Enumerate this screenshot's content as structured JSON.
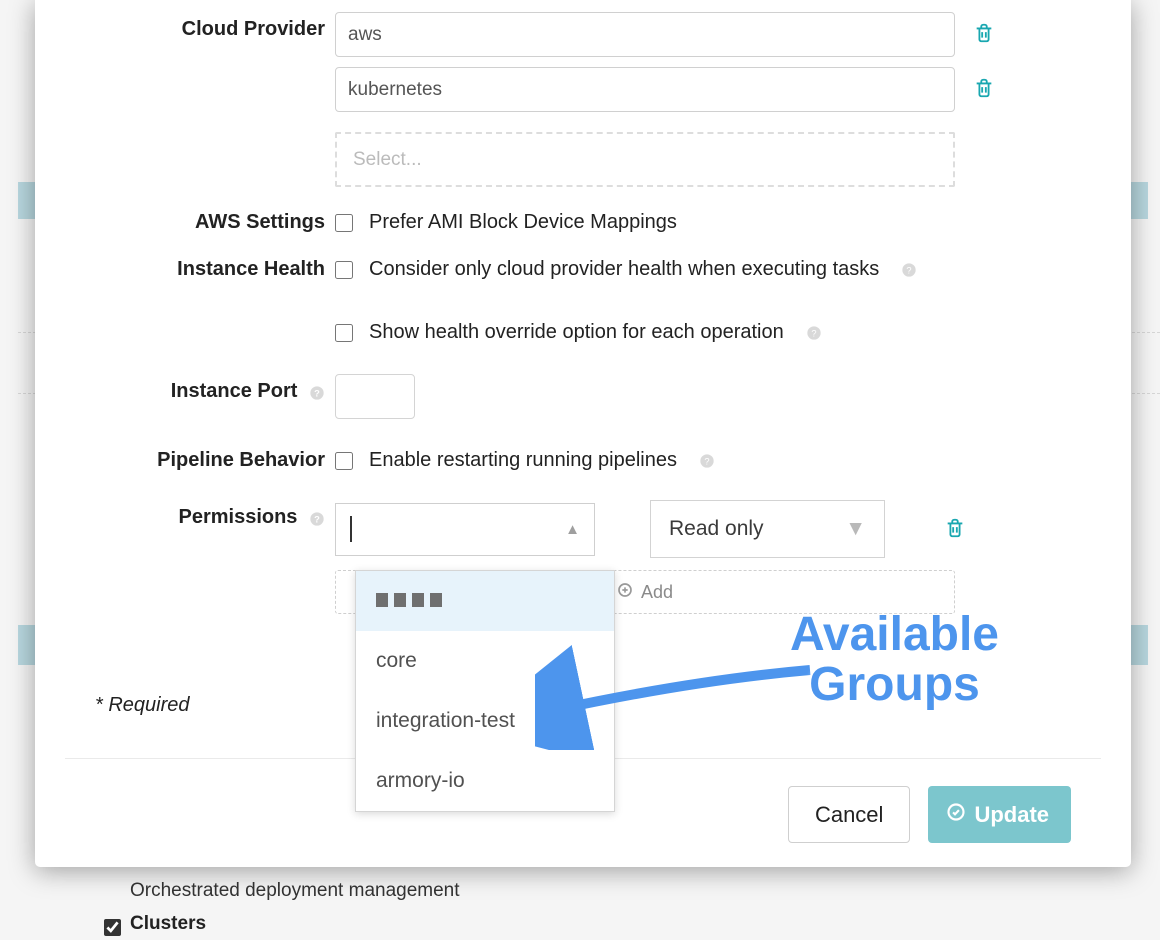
{
  "backdrop": {
    "orchestrated_label": "Orchestrated deployment management",
    "clusters_label": "Clusters"
  },
  "form": {
    "cloud_provider": {
      "label": "Cloud Provider",
      "values": [
        "aws",
        "kubernetes"
      ],
      "select_placeholder": "Select..."
    },
    "aws_settings": {
      "label": "AWS Settings",
      "option": "Prefer AMI Block Device Mappings"
    },
    "instance_health": {
      "label": "Instance Health",
      "option1": "Consider only cloud provider health when executing tasks",
      "option2": "Show health override option for each operation"
    },
    "instance_port": {
      "label": "Instance Port",
      "value": ""
    },
    "pipeline_behavior": {
      "label": "Pipeline Behavior",
      "option": "Enable restarting running pipelines"
    },
    "permissions": {
      "label": "Permissions",
      "level_selected": "Read only",
      "add_label": "Add",
      "dropdown_options": [
        "core",
        "integration-test",
        "armory-io"
      ]
    },
    "required_note": "* Required",
    "buttons": {
      "cancel": "Cancel",
      "update": "Update"
    }
  },
  "annotation": {
    "line1": "Available",
    "line2": "Groups"
  },
  "colors": {
    "accent_teal": "#19a7b0",
    "update_bg": "#7cc6cd",
    "arrow_blue": "#4d95ed"
  }
}
